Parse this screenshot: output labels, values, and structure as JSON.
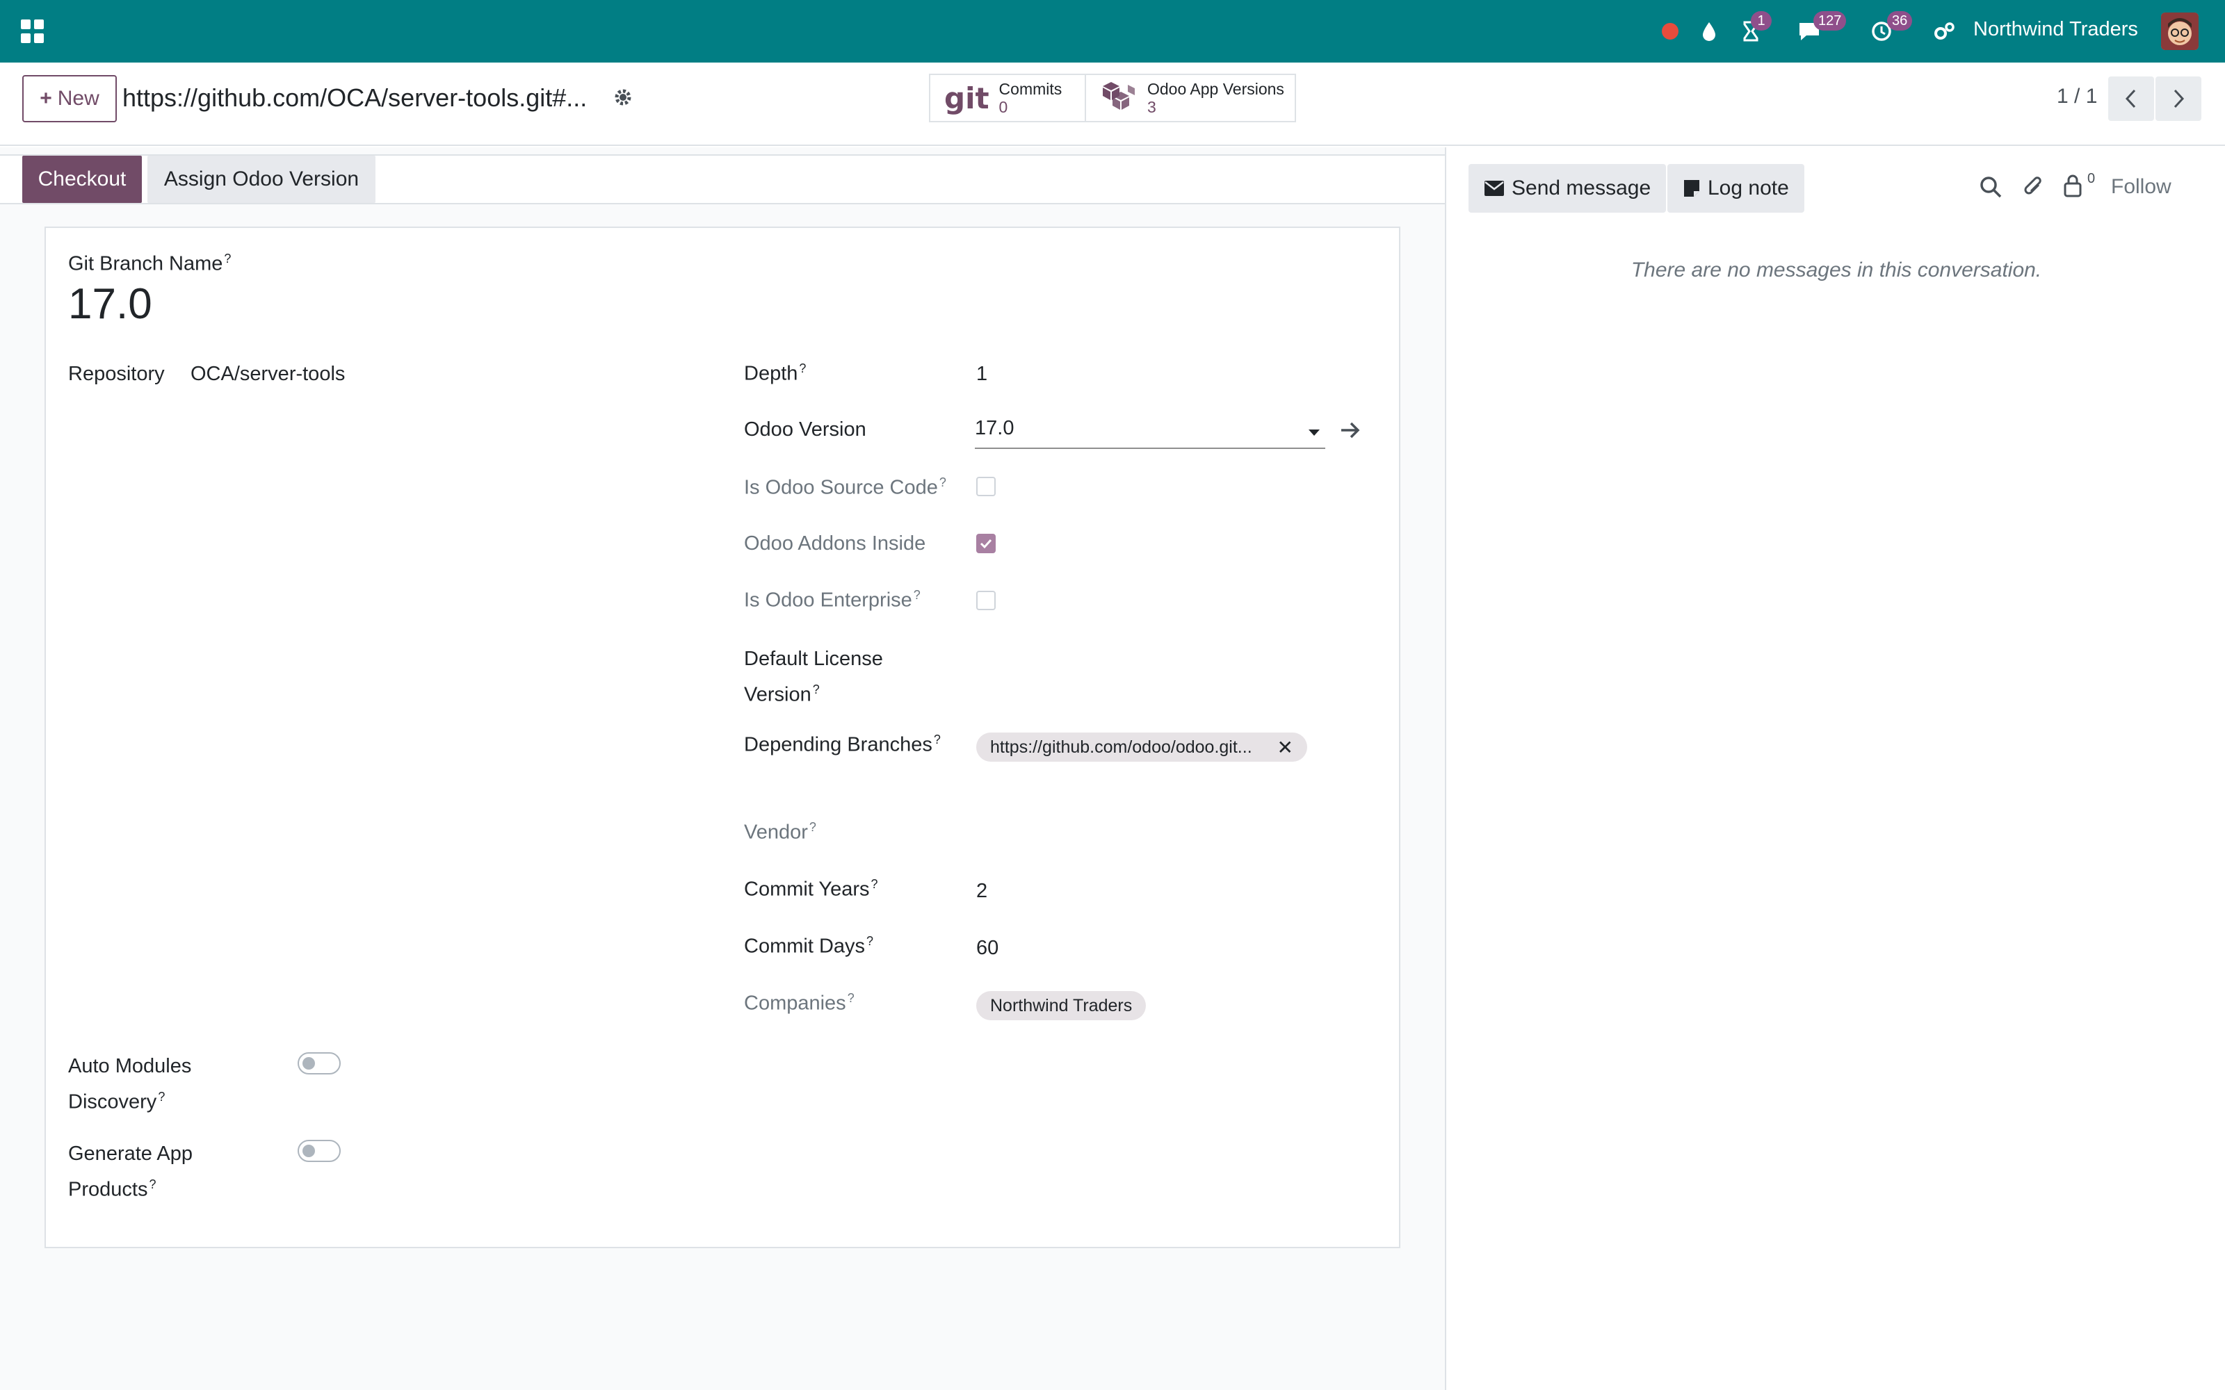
{
  "navbar": {
    "company": "Northwind Traders",
    "badges": {
      "activities": "1",
      "messages": "127",
      "timer": "36"
    },
    "icons": [
      "apps-icon",
      "record-dot-icon",
      "drop-icon",
      "hourglass-icon",
      "chat-icon",
      "clock-icon",
      "settings-icon"
    ]
  },
  "control_panel": {
    "new_label": "New",
    "record_title": "https://github.com/OCA/server-tools.git#...",
    "smart_buttons": [
      {
        "label": "Commits",
        "value": "0"
      },
      {
        "label": "Odoo App Versions",
        "value": "3"
      }
    ],
    "pager": "1 / 1"
  },
  "statusbar": {
    "checkout_label": "Checkout",
    "assign_label": "Assign Odoo Version"
  },
  "form": {
    "branch_name_label": "Git Branch Name",
    "branch_name": "17.0",
    "repository_label": "Repository",
    "repository_value": "OCA/server-tools",
    "depth_label": "Depth",
    "depth_value": "1",
    "odoo_version_label": "Odoo Version",
    "odoo_version_value": "17.0",
    "is_source_code_label": "Is Odoo Source Code",
    "addons_inside_label": "Odoo Addons Inside",
    "is_enterprise_label": "Is Odoo Enterprise",
    "license_label_1": "Default License",
    "license_label_2": "Version",
    "depending_label": "Depending Branches",
    "depending_tag": "https://github.com/odoo/odoo.git...",
    "vendor_label": "Vendor",
    "commit_years_label": "Commit Years",
    "commit_years_value": "2",
    "commit_days_label": "Commit Days",
    "commit_days_value": "60",
    "companies_label": "Companies",
    "companies_tag": "Northwind Traders",
    "auto_discovery_label_1": "Auto Modules",
    "auto_discovery_label_2": "Discovery",
    "generate_products_label_1": "Generate App",
    "generate_products_label_2": "Products",
    "help_mark": "?"
  },
  "chatter": {
    "send_message": "Send message",
    "log_note": "Log note",
    "followers_count": "0",
    "follow": "Follow",
    "empty_text": "There are no messages in this conversation."
  },
  "colors": {
    "navbar": "#017e84",
    "brand": "#714b67",
    "badge": "#8f4f8b"
  }
}
